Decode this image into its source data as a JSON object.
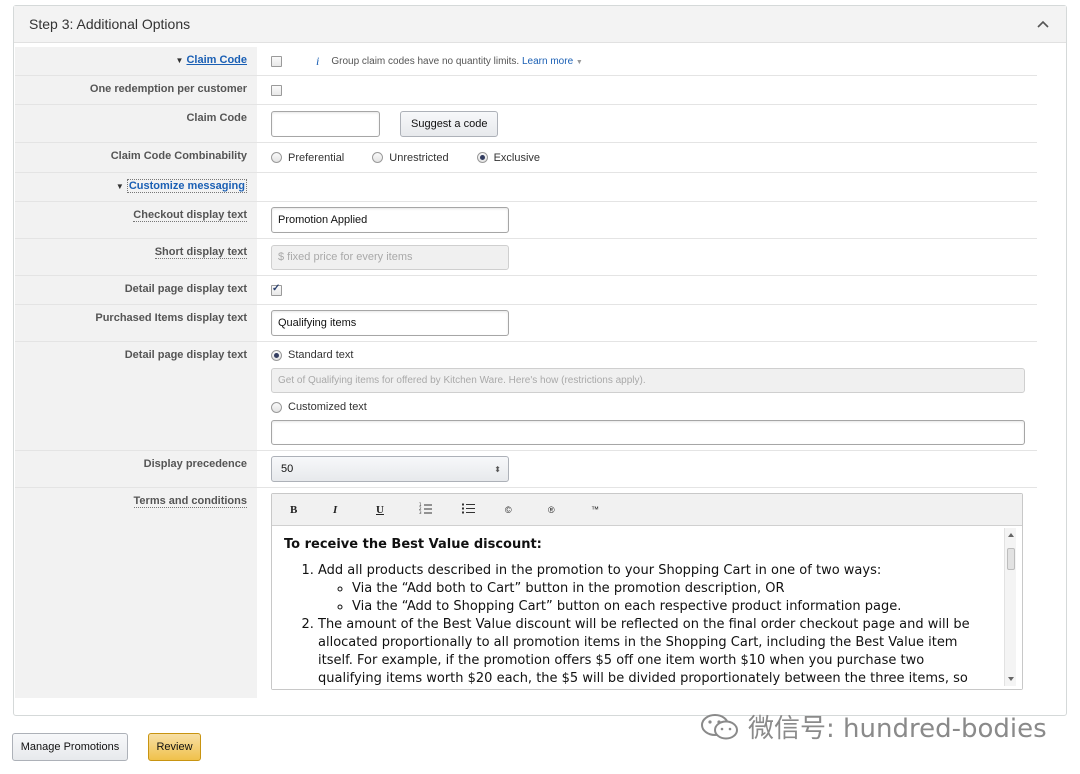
{
  "panel": {
    "title": "Step 3: Additional Options"
  },
  "claim_code_toggle": {
    "label": "Claim Code",
    "note": "Group claim codes have no quantity limits.",
    "learn_more": "Learn more"
  },
  "one_redemption": {
    "label": "One redemption per customer"
  },
  "claim_code": {
    "label": "Claim Code",
    "value": "",
    "suggest_button": "Suggest a code"
  },
  "combinability": {
    "label": "Claim Code Combinability",
    "options": [
      "Preferential",
      "Unrestricted",
      "Exclusive"
    ],
    "selected": "Exclusive"
  },
  "customize_messaging": {
    "label": "Customize messaging"
  },
  "checkout_display": {
    "label": "Checkout display text",
    "value": "Promotion Applied"
  },
  "short_display": {
    "label": "Short display text",
    "value": "$ fixed price for every  items"
  },
  "detail_page_checkbox": {
    "label": "Detail page display text",
    "checked": true
  },
  "purchased_items": {
    "label": "Purchased Items display text",
    "value": "Qualifying items"
  },
  "detail_page_text": {
    "label": "Detail page display text",
    "standard_label": "Standard text",
    "standard_value": "Get of Qualifying items for offered by Kitchen Ware. Here's how (restrictions apply).",
    "custom_label": "Customized text",
    "custom_value": ""
  },
  "display_precedence": {
    "label": "Display precedence",
    "value": "50"
  },
  "terms": {
    "label": "Terms and conditions",
    "toolbar": [
      "B",
      "I",
      "U",
      "☰",
      "☰",
      "©",
      "®",
      "™"
    ],
    "heading": "To receive the Best Value discount:",
    "item1": "Add all products described in the promotion to your Shopping Cart in one of two ways:",
    "sub1": "Via the  “Add both to Cart”   button in the promotion description, OR",
    "sub2": "Via the  “Add to Shopping Cart”   button on each respective product information page.",
    "item2_a": "The amount of the Best Value discount will be reflected on the final order checkout page and will be allocated proportionally to all promotion items in the Shopping Cart, including the Best Value item itself.",
    "item2_b": "For example, if the promotion offers $5 off one item worth $10 when you purchase two qualifying items worth $20 each, the $5 will be divided proportionately between the three items, so that the Best Value item"
  },
  "footer": {
    "manage": "Manage Promotions",
    "review": "Review"
  },
  "watermark": "微信号: hundred-bodies"
}
